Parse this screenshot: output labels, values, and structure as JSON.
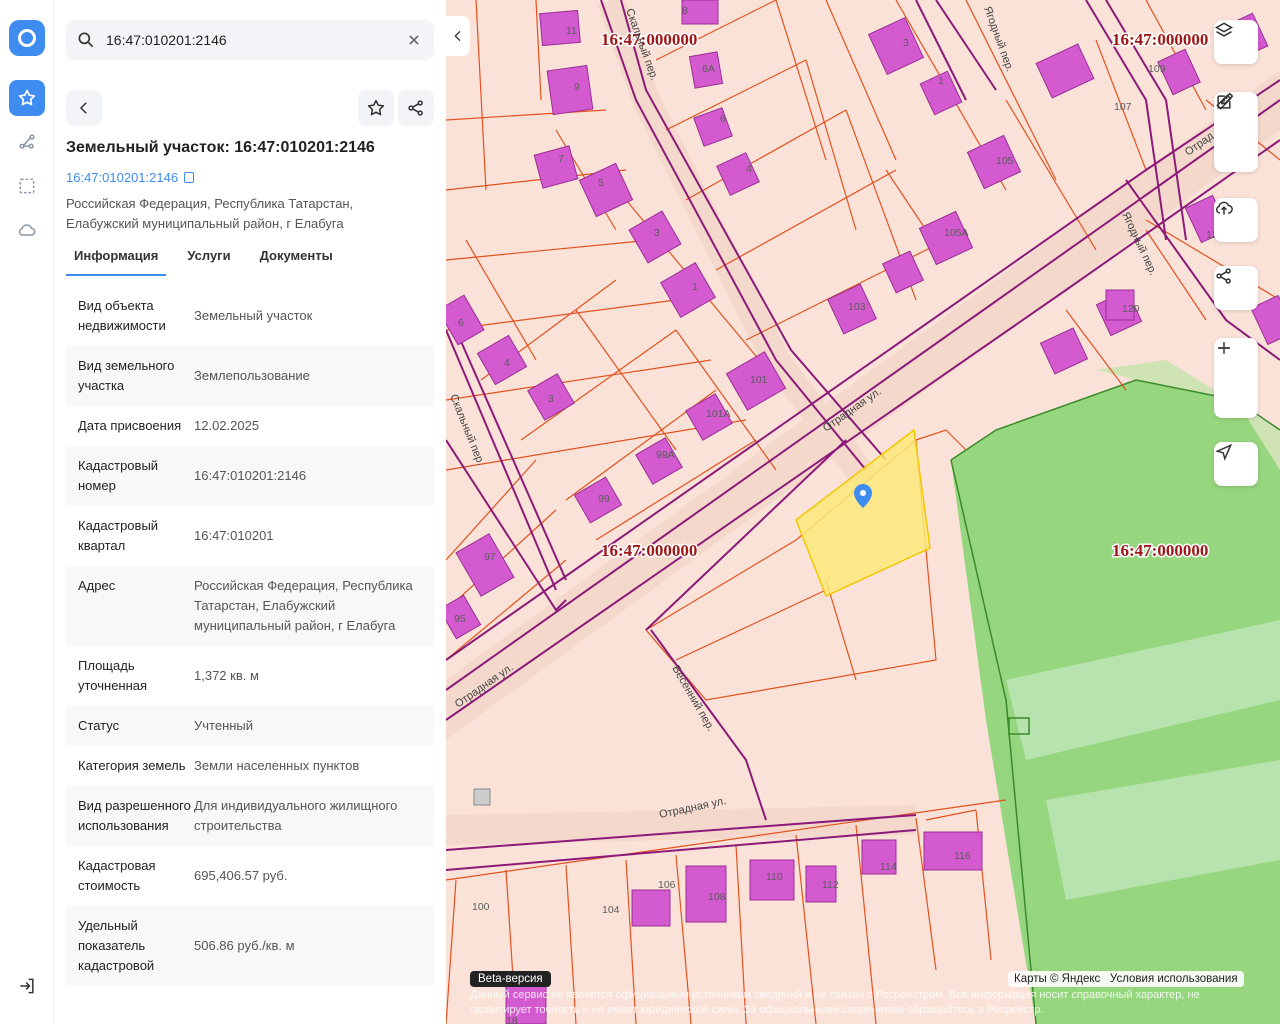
{
  "search": {
    "query": "16:47:010201:2146"
  },
  "object": {
    "title": "Земельный участок: 16:47:010201:2146",
    "cad_number": "16:47:010201:2146",
    "address_line1": "Российская Федерация, Республика Татарстан,",
    "address_line2": "Елабужский муниципальный район, г Елабуга"
  },
  "tabs": [
    "Информация",
    "Услуги",
    "Документы"
  ],
  "rows": [
    {
      "k": "Вид объекта недвижимости",
      "v": "Земельный участок"
    },
    {
      "k": "Вид земельного участка",
      "v": "Землепользование"
    },
    {
      "k": "Дата присвоения",
      "v": "12.02.2025"
    },
    {
      "k": "Кадастровый номер",
      "v": "16:47:010201:2146"
    },
    {
      "k": "Кадастровый квартал",
      "v": "16:47:010201"
    },
    {
      "k": "Адрес",
      "v": "Российская Федерация, Республика Татарстан, Елабужский муниципальный район, г Елабуга"
    },
    {
      "k": "Площадь уточненная",
      "v": "1,372 кв. м"
    },
    {
      "k": "Статус",
      "v": "Учтенный"
    },
    {
      "k": "Категория земель",
      "v": "Земли населенных пунктов"
    },
    {
      "k": "Вид разрешенного использования",
      "v": "Для индивидуального жилищного строительства"
    },
    {
      "k": "Кадастровая стоимость",
      "v": "695,406.57 руб."
    },
    {
      "k": "Удельный показатель кадастровой",
      "v": "506.86 руб./кв. м"
    }
  ],
  "map": {
    "quarter_labels": [
      "16:47:000000",
      "16:47:000000",
      "16:47:000000",
      "16:47:000000"
    ],
    "streets": [
      "Скальный пер.",
      "Ягодный пер.",
      "Отрадная ул.",
      "Ягодный пер.",
      "Скальный пер.",
      "Отрадная ул.",
      "Отрадная ул.",
      "Весенний пер.",
      "Отрад"
    ],
    "house_numbers": [
      "11",
      "8",
      "9",
      "6А",
      "7",
      "6",
      "5",
      "4",
      "3",
      "1",
      "3",
      "1",
      "109",
      "107",
      "105",
      "105А",
      "103",
      "120",
      "6",
      "4",
      "3",
      "101",
      "101А",
      "99А",
      "99",
      "97",
      "95",
      "100",
      "104",
      "106",
      "108",
      "110",
      "112",
      "114",
      "116",
      "18",
      "12"
    ]
  },
  "attribution": {
    "beta": "Beta-версия",
    "maps": "Карты © Яндекс",
    "terms": "Условия использования",
    "disclaimer": "Данный сервис не является официальным источником сведений и не связан с Росреестром. Вся информация носит справочный характер, не гарантирует точность и не имеет юридической силы. За официальными сведениями обращайтесь в Росреестр."
  },
  "colors": {
    "accent": "#3f8cf0",
    "parcel_line": "#e2521f",
    "quarter_line": "#8b1a78",
    "building": "#d45ad0",
    "forest": "#96d67e",
    "selected": "#fbe97a"
  }
}
